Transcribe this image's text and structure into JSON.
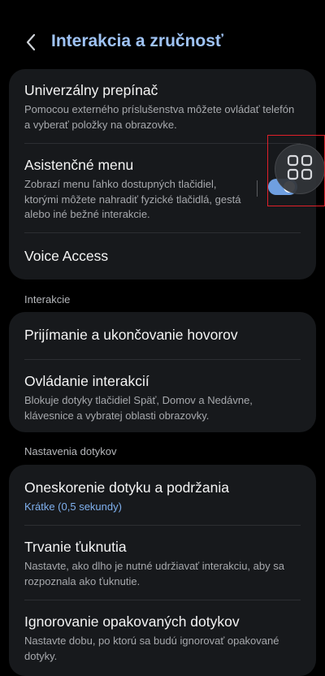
{
  "header": {
    "title": "Interakcia a zručnosť",
    "back_icon": "chevron-left-icon",
    "accent_color": "#9fc3f5"
  },
  "card1": {
    "switch_access": {
      "title": "Univerzálny prepínač",
      "subtitle": "Pomocou externého príslušenstva môžete ovládať telefón a vyberať položky na obrazovke."
    },
    "assistant_menu": {
      "title": "Asistenčné menu",
      "subtitle": "Zobrazí menu ľahko dostupných tlačidiel, ktorými môžete nahradiť fyzické tlačidlá, gestá alebo iné bežné interakcie.",
      "enabled": true,
      "float_icon": "assistant-menu-grid-icon"
    },
    "voice_access": {
      "title": "Voice Access"
    }
  },
  "interactions_section": {
    "label": "Interakcie",
    "answering_calls": {
      "title": "Prijímanie a ukončovanie hovorov"
    },
    "interaction_control": {
      "title": "Ovládanie interakcií",
      "subtitle": "Blokuje dotyky tlačidiel Späť, Domov a Nedávne, klávesnice a vybratej oblasti obrazovky."
    }
  },
  "touch_section": {
    "label": "Nastavenia dotykov",
    "touch_hold_delay": {
      "title": "Oneskorenie dotyku a podržania",
      "value": "Krátke (0,5 sekundy)"
    },
    "tap_duration": {
      "title": "Trvanie ťuknutia",
      "subtitle": "Nastavte, ako dlho je nutné udržiavať interakciu, aby sa rozpoznala ako ťuknutie."
    },
    "ignore_repeated": {
      "title": "Ignorovanie opakovaných dotykov",
      "subtitle": "Nastavte dobu, po ktorú sa budú ignorovať opakované dotyky."
    }
  },
  "colors": {
    "background": "#000000",
    "card": "#17191c",
    "toggle_on": "#6f9fe0",
    "link_value": "#7fb0ee"
  }
}
